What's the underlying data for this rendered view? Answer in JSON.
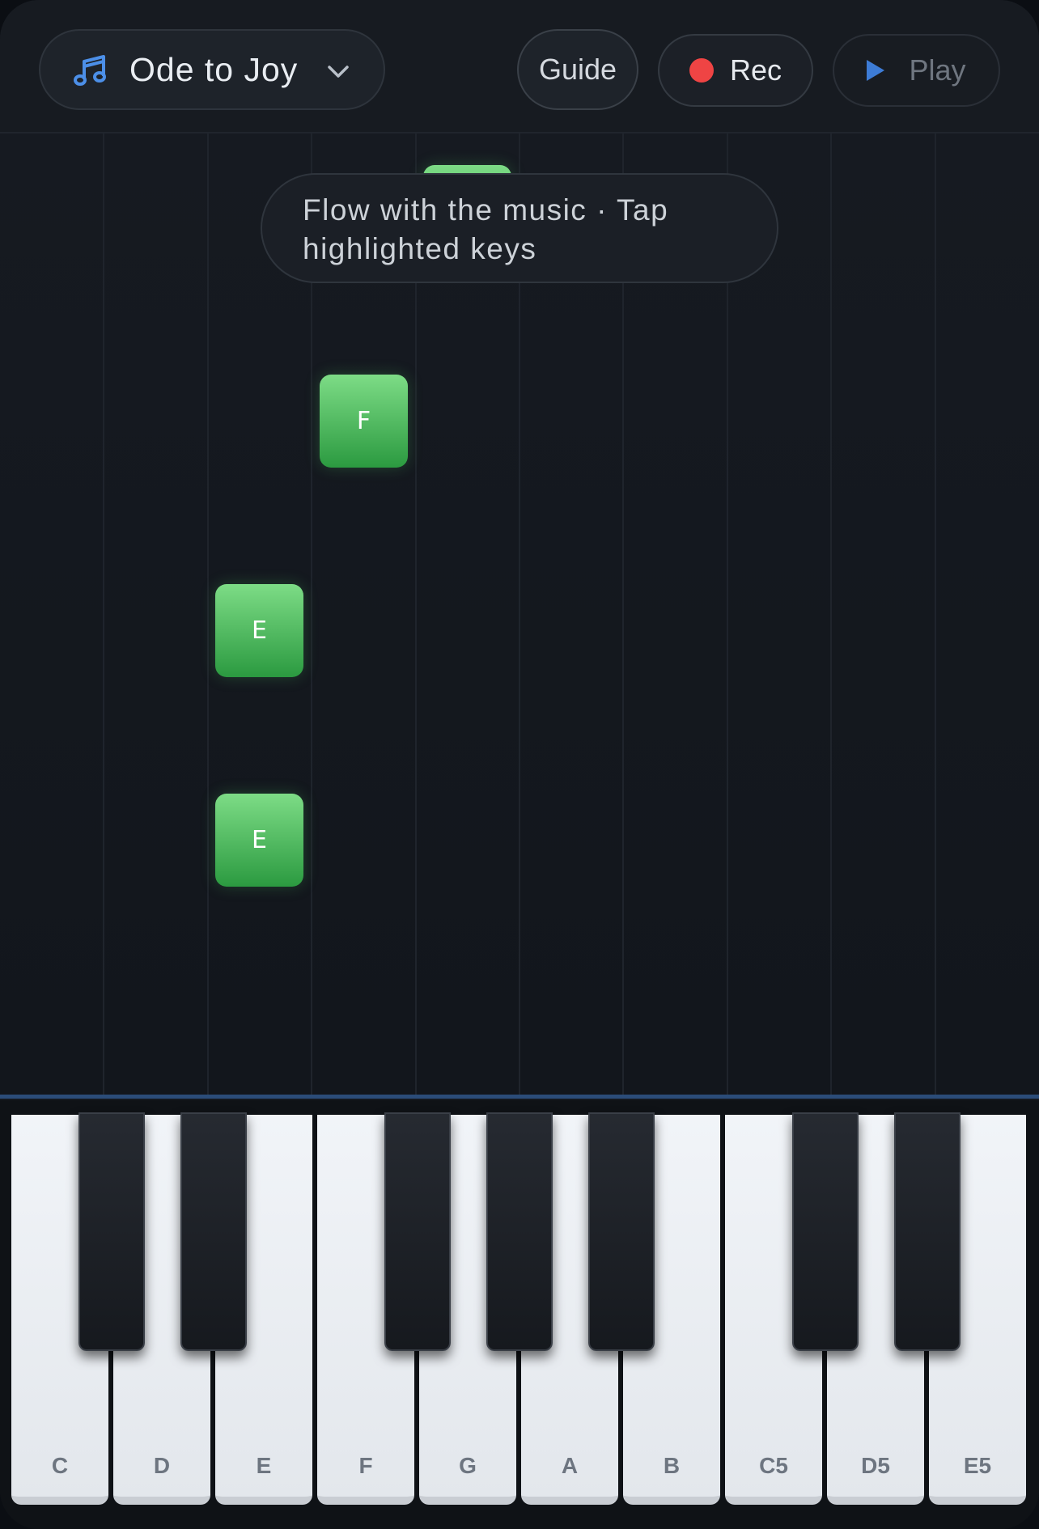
{
  "header": {
    "song_title": "Ode to Joy",
    "song_icon": "music-note-icon",
    "dropdown_icon": "chevron-down-icon",
    "guide_label": "Guide",
    "rec_label": "Rec",
    "play_label": "Play",
    "accent_color": "#3d7cd6",
    "rec_color": "#ef4444"
  },
  "hint": {
    "line1": "Flow with the music · Tap",
    "line2": "highlighted keys"
  },
  "falling_notes": [
    {
      "label": "",
      "lane": "G"
    },
    {
      "label": "F",
      "lane": "F"
    },
    {
      "label": "E",
      "lane": "E"
    },
    {
      "label": "E",
      "lane": "E"
    }
  ],
  "note_color": "#4cc35c",
  "keyboard": {
    "white_keys": [
      "C",
      "D",
      "E",
      "F",
      "G",
      "A",
      "B",
      "C5",
      "D5",
      "E5"
    ]
  }
}
